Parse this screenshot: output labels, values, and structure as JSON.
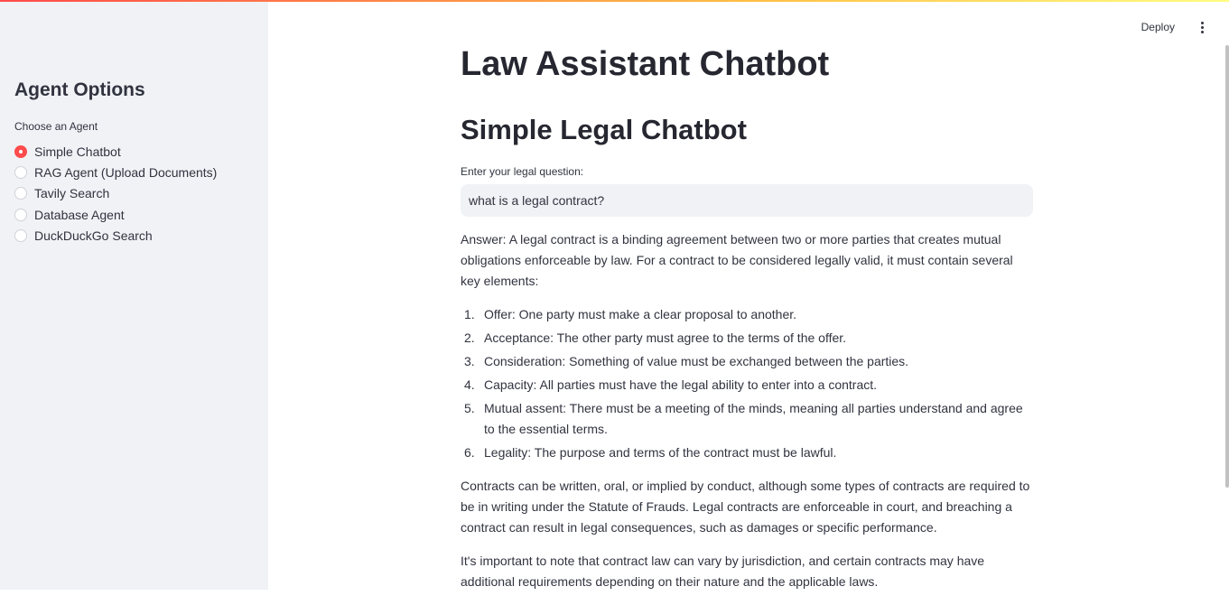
{
  "sidebar": {
    "title": "Agent Options",
    "radio_label": "Choose an Agent",
    "options": [
      {
        "label": "Simple Chatbot",
        "selected": true
      },
      {
        "label": "RAG Agent (Upload Documents)",
        "selected": false
      },
      {
        "label": "Tavily Search",
        "selected": false
      },
      {
        "label": "Database Agent",
        "selected": false
      },
      {
        "label": "DuckDuckGo Search",
        "selected": false
      }
    ]
  },
  "header": {
    "deploy_label": "Deploy",
    "menu_icon": "kebab-menu-icon"
  },
  "main": {
    "title": "Law Assistant Chatbot",
    "subtitle": "Simple Legal Chatbot",
    "input_label": "Enter your legal question:",
    "input_value": "what is a legal contract?",
    "answer_intro": "Answer: A legal contract is a binding agreement between two or more parties that creates mutual obligations enforceable by law. For a contract to be considered legally valid, it must contain several key elements:",
    "answer_items": [
      {
        "num": "1.",
        "text": "Offer: One party must make a clear proposal to another."
      },
      {
        "num": "2.",
        "text": "Acceptance: The other party must agree to the terms of the offer."
      },
      {
        "num": "3.",
        "text": "Consideration: Something of value must be exchanged between the parties."
      },
      {
        "num": "4.",
        "text": "Capacity: All parties must have the legal ability to enter into a contract."
      },
      {
        "num": "5.",
        "text": "Mutual assent: There must be a meeting of the minds, meaning all parties understand and agree to the essential terms."
      },
      {
        "num": "6.",
        "text": "Legality: The purpose and terms of the contract must be lawful."
      }
    ],
    "answer_para2": "Contracts can be written, oral, or implied by conduct, although some types of contracts are required to be in writing under the Statute of Frauds. Legal contracts are enforceable in court, and breaching a contract can result in legal consequences, such as damages or specific performance.",
    "answer_para3": "It's important to note that contract law can vary by jurisdiction, and certain contracts may have additional requirements depending on their nature and the applicable laws."
  },
  "colors": {
    "accent": "#ff4b4b",
    "sidebar_bg": "#f0f2f6",
    "text": "#31333f"
  }
}
